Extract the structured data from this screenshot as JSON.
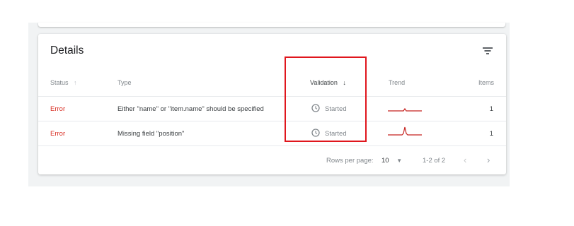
{
  "panel": {
    "title": "Details"
  },
  "columns": {
    "status": "Status",
    "type": "Type",
    "validation": "Validation",
    "trend": "Trend",
    "items": "Items"
  },
  "rows": [
    {
      "status": "Error",
      "type": "Either \"name\" or \"item.name\" should be specified",
      "validation": "Started",
      "items": "1"
    },
    {
      "status": "Error",
      "type": "Missing field \"position\"",
      "validation": "Started",
      "items": "1"
    }
  ],
  "footer": {
    "rows_per_page_label": "Rows per page:",
    "rows_per_page_value": "10",
    "range": "1-2 of 2"
  },
  "icons": {
    "status_sort": "arrow-up-icon",
    "validation_sort": "arrow-down-icon",
    "filter": "filter-icon",
    "validation_state": "clock-icon",
    "rows_dropdown": "caret-down-icon",
    "prev": "chevron-left-icon",
    "next": "chevron-right-icon"
  },
  "colors": {
    "error": "#d93025",
    "trend": "#c5221f",
    "highlight": "#e0161d"
  }
}
